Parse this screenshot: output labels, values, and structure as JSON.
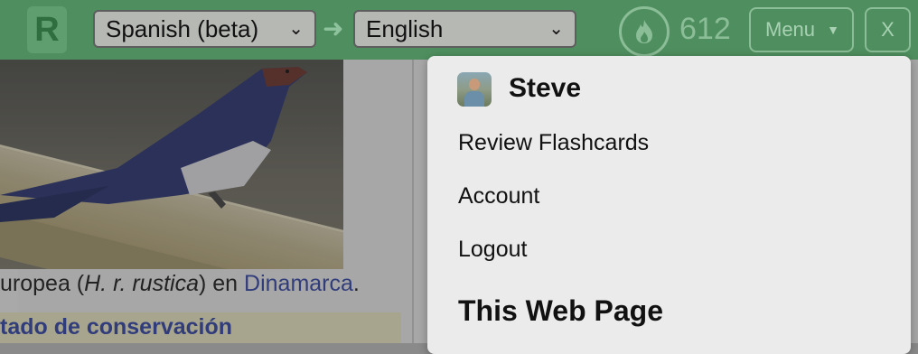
{
  "toolbar": {
    "logo_letter": "R",
    "source_language": "Spanish (beta)",
    "target_language": "English",
    "streak_count": "612",
    "menu_label": "Menu",
    "close_label": "X"
  },
  "page": {
    "caption_prefix": "uropea (",
    "caption_italic": "H. r. rustica",
    "caption_mid": ") en ",
    "caption_link": "Dinamarca",
    "caption_suffix": ".",
    "section_title": "tado de conservación"
  },
  "dropdown": {
    "username": "Steve",
    "items": [
      {
        "label": "Review Flashcards"
      },
      {
        "label": "Account"
      },
      {
        "label": "Logout"
      }
    ],
    "section_heading": "This Web Page"
  },
  "colors": {
    "toolbar_green": "#4f8f5f",
    "link_blue": "#2a3ea8"
  }
}
